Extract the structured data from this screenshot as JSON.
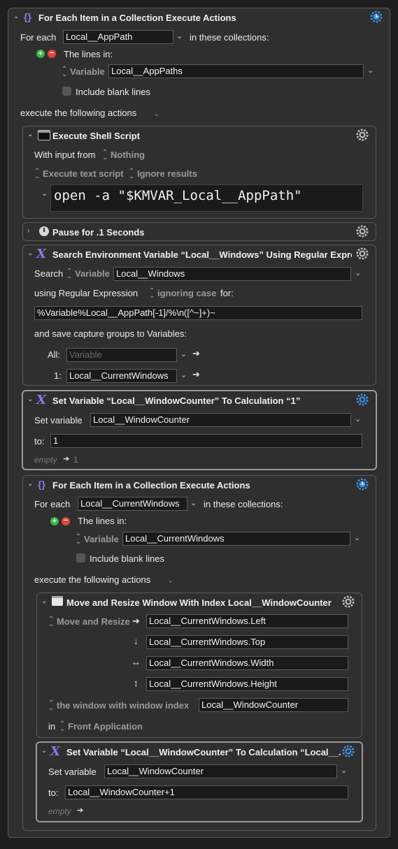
{
  "outer": {
    "title": "For Each Item in a Collection Execute Actions",
    "for_each_label": "For each",
    "var_value": "Local__AppPath",
    "in_collections": "in these collections:",
    "lines_in": "The lines in:",
    "variable_label": "Variable",
    "variable_value": "Local__AppPaths",
    "include_blank": "Include blank lines",
    "execute_label": "execute the following actions"
  },
  "shell": {
    "title": "Execute Shell Script",
    "with_input": "With input from",
    "input_value": "Nothing",
    "execute_text": "Execute text script",
    "ignore_results": "Ignore results",
    "script": "open -a \"$KMVAR_Local__AppPath\""
  },
  "pause": {
    "title": "Pause for .1 Seconds"
  },
  "search": {
    "title": "Search Environment Variable “Local__Windows” Using Regular Expre...",
    "search_label": "Search",
    "variable_label": "Variable",
    "variable_value": "Local__Windows",
    "using_regex": "using Regular Expression",
    "ignoring_case": "ignoring case",
    "for_label": "for:",
    "regex": "%Variable%Local__AppPath[-1]/%\\n([^~]+)~",
    "save_groups": "and save capture groups to Variables:",
    "all_label": "All:",
    "all_placeholder": "Variable",
    "one_label": "1:",
    "one_value": "Local__CurrentWindows"
  },
  "setvar1": {
    "title": "Set Variable “Local__WindowCounter” To Calculation “1”",
    "set_variable": "Set variable",
    "variable_value": "Local__WindowCounter",
    "to_label": "to:",
    "to_value": "1",
    "empty_label": "empty",
    "empty_result": "1"
  },
  "inner": {
    "title": "For Each Item in a Collection Execute Actions",
    "for_each_label": "For each",
    "var_value": "Local__CurrentWindows",
    "in_collections": "in these collections:",
    "lines_in": "The lines in:",
    "variable_label": "Variable",
    "variable_value": "Local__CurrentWindows",
    "include_blank": "Include blank lines",
    "execute_label": "execute the following actions"
  },
  "move": {
    "title": "Move and Resize Window With Index Local__WindowCounter",
    "mode_label": "Move and Resize",
    "left": "Local__CurrentWindows.Left",
    "top": "Local__CurrentWindows.Top",
    "width": "Local__CurrentWindows.Width",
    "height": "Local__CurrentWindows.Height",
    "window_index_label": "the window with window index",
    "window_index_value": "Local__WindowCounter",
    "in_label": "in",
    "app_label": "Front Application"
  },
  "setvar2": {
    "title": "Set Variable “Local__WindowCounter” To Calculation “Local__...",
    "set_variable": "Set variable",
    "variable_value": "Local__WindowCounter",
    "to_label": "to:",
    "to_value": "Local__WindowCounter+1",
    "empty_label": "empty"
  },
  "colors": {
    "accent": "#8a7be6",
    "gear_blue": "#3d8fe0",
    "plus": "#3ab34a",
    "minus": "#e0443d"
  }
}
